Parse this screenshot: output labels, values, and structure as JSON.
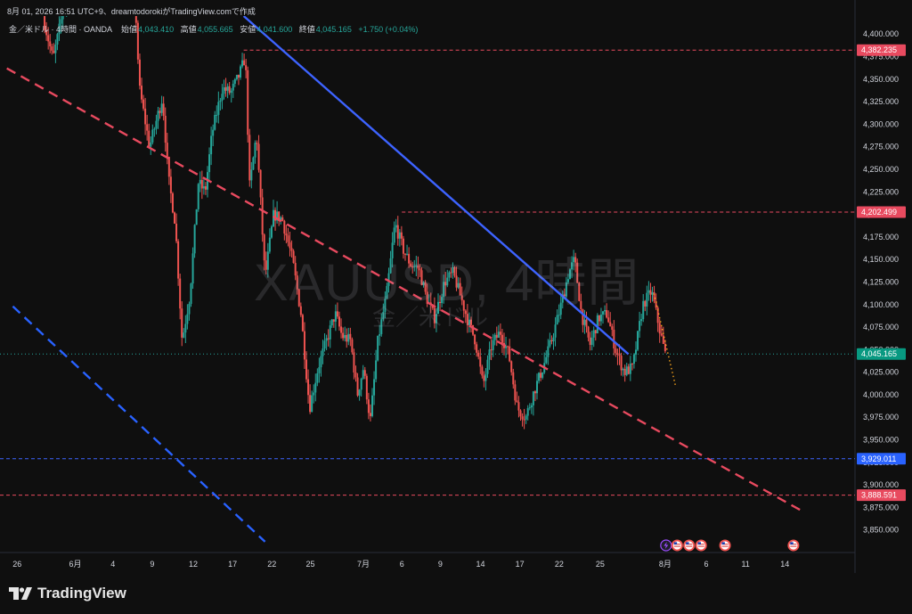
{
  "header": {
    "attribution": "8月 01, 2026 16:51 UTC+9、dreamtodorokiがTradingView.comで作成"
  },
  "legend": {
    "symbol_line": "金／米ドル · 4時間 · OANDA",
    "open_label": "始値",
    "open_value": "4,043.410",
    "high_label": "高値",
    "high_value": "4,055.665",
    "low_label": "安値",
    "low_value": "4,041.600",
    "close_label": "終値",
    "close_value": "4,045.165",
    "change_value": "+1.750 (+0.04%)"
  },
  "watermark": {
    "ticker": "XAUUSD, 4時間",
    "name": "金／米ドル"
  },
  "branding": {
    "name": "TradingView"
  },
  "colors": {
    "background": "#0f0f0f",
    "up": "#26a69a",
    "down": "#ef5350",
    "blue_trend": "#3d63ff",
    "red_dash": "#e84a5f",
    "blue_dash": "#2962ff"
  },
  "chart_data": {
    "type": "candlestick",
    "symbol": "XAUUSD",
    "timeframe": "4時間",
    "ylim": [
      3825,
      4420
    ],
    "y_ticks": [
      "4,400.000",
      "4,375.000",
      "4,350.000",
      "4,325.000",
      "4,300.000",
      "4,275.000",
      "4,250.000",
      "4,225.000",
      "4,200.000",
      "4,175.000",
      "4,150.000",
      "4,125.000",
      "4,100.000",
      "4,075.000",
      "4,050.000",
      "4,025.000",
      "4,000.000",
      "3,975.000",
      "3,950.000",
      "3,925.000",
      "3,900.000",
      "3,875.000",
      "3,850.000"
    ],
    "x_ticks": [
      {
        "label": "26",
        "pos": 0.02
      },
      {
        "label": "6月",
        "pos": 0.088
      },
      {
        "label": "4",
        "pos": 0.132
      },
      {
        "label": "9",
        "pos": 0.178
      },
      {
        "label": "12",
        "pos": 0.226
      },
      {
        "label": "17",
        "pos": 0.272
      },
      {
        "label": "22",
        "pos": 0.318
      },
      {
        "label": "25",
        "pos": 0.363
      },
      {
        "label": "7月",
        "pos": 0.425
      },
      {
        "label": "6",
        "pos": 0.47
      },
      {
        "label": "9",
        "pos": 0.515
      },
      {
        "label": "14",
        "pos": 0.562
      },
      {
        "label": "17",
        "pos": 0.608
      },
      {
        "label": "22",
        "pos": 0.654
      },
      {
        "label": "25",
        "pos": 0.702
      },
      {
        "label": "8月",
        "pos": 0.778
      },
      {
        "label": "6",
        "pos": 0.826
      },
      {
        "label": "11",
        "pos": 0.872
      },
      {
        "label": "14",
        "pos": 0.918
      }
    ],
    "price_path": [
      [
        0.05,
        4420
      ],
      [
        0.062,
        4372
      ],
      [
        0.075,
        4432
      ],
      [
        0.1,
        4455
      ],
      [
        0.13,
        4470
      ],
      [
        0.158,
        4440
      ],
      [
        0.163,
        4340
      ],
      [
        0.175,
        4275
      ],
      [
        0.19,
        4330
      ],
      [
        0.197,
        4240
      ],
      [
        0.205,
        4190
      ],
      [
        0.213,
        4060
      ],
      [
        0.222,
        4110
      ],
      [
        0.232,
        4235
      ],
      [
        0.24,
        4225
      ],
      [
        0.248,
        4290
      ],
      [
        0.26,
        4340
      ],
      [
        0.27,
        4335
      ],
      [
        0.28,
        4355
      ],
      [
        0.287,
        4375
      ],
      [
        0.292,
        4230
      ],
      [
        0.3,
        4290
      ],
      [
        0.31,
        4130
      ],
      [
        0.32,
        4200
      ],
      [
        0.33,
        4195
      ],
      [
        0.342,
        4150
      ],
      [
        0.352,
        4090
      ],
      [
        0.362,
        3985
      ],
      [
        0.372,
        4030
      ],
      [
        0.382,
        4060
      ],
      [
        0.392,
        4090
      ],
      [
        0.4,
        4065
      ],
      [
        0.41,
        4060
      ],
      [
        0.418,
        4000
      ],
      [
        0.425,
        4030
      ],
      [
        0.433,
        3970
      ],
      [
        0.442,
        4060
      ],
      [
        0.452,
        4110
      ],
      [
        0.462,
        4190
      ],
      [
        0.472,
        4160
      ],
      [
        0.48,
        4145
      ],
      [
        0.49,
        4140
      ],
      [
        0.498,
        4110
      ],
      [
        0.508,
        4085
      ],
      [
        0.52,
        4125
      ],
      [
        0.53,
        4135
      ],
      [
        0.54,
        4105
      ],
      [
        0.548,
        4080
      ],
      [
        0.556,
        4060
      ],
      [
        0.565,
        4010
      ],
      [
        0.575,
        4055
      ],
      [
        0.585,
        4070
      ],
      [
        0.595,
        4045
      ],
      [
        0.605,
        3985
      ],
      [
        0.615,
        3975
      ],
      [
        0.625,
        4005
      ],
      [
        0.635,
        4030
      ],
      [
        0.645,
        4060
      ],
      [
        0.655,
        4095
      ],
      [
        0.665,
        4135
      ],
      [
        0.672,
        4150
      ],
      [
        0.68,
        4090
      ],
      [
        0.69,
        4055
      ],
      [
        0.7,
        4085
      ],
      [
        0.71,
        4090
      ],
      [
        0.72,
        4050
      ],
      [
        0.73,
        4025
      ],
      [
        0.74,
        4030
      ],
      [
        0.752,
        4100
      ],
      [
        0.762,
        4115
      ],
      [
        0.772,
        4070
      ],
      [
        0.778,
        4045
      ]
    ],
    "dotted_projection": [
      [
        0.765,
        4112
      ],
      [
        0.79,
        4010
      ]
    ],
    "lines": [
      {
        "type": "trend",
        "style": "solid",
        "color": "blue",
        "points": [
          [
            0.285,
            4420
          ],
          [
            0.735,
            4045
          ]
        ]
      },
      {
        "type": "trend",
        "style": "dashed",
        "color": "red",
        "points": [
          [
            0.008,
            4362
          ],
          [
            0.94,
            3870
          ]
        ]
      },
      {
        "type": "trend",
        "style": "dashed",
        "color": "blue",
        "points": [
          [
            0.015,
            4098
          ],
          [
            0.31,
            3837
          ]
        ]
      },
      {
        "type": "horizontal",
        "style": "dashed",
        "color": "red",
        "price": 4382.235,
        "from": 0.285
      },
      {
        "type": "horizontal",
        "style": "dashed",
        "color": "red",
        "price": 4202.499,
        "from": 0.47
      },
      {
        "type": "horizontal",
        "style": "dashed",
        "color": "blue",
        "price": 3929.011,
        "from": 0.0
      },
      {
        "type": "horizontal",
        "style": "dashed",
        "color": "red",
        "price": 3888.591,
        "from": 0.0
      },
      {
        "type": "horizontal",
        "style": "dotted",
        "color": "green",
        "price": 4045.165,
        "from": 0.0
      }
    ],
    "price_labels": [
      {
        "text": "4,382.235",
        "price": 4382.235,
        "color": "#e84a5f"
      },
      {
        "text": "4,202.499",
        "price": 4202.499,
        "color": "#e84a5f"
      },
      {
        "text": "4,045.165",
        "price": 4045.165,
        "color": "#089981"
      },
      {
        "text": "3,929.011",
        "price": 3929.011,
        "color": "#2962ff"
      },
      {
        "text": "3,888.591",
        "price": 3888.591,
        "color": "#e84a5f"
      }
    ],
    "events": [
      {
        "kind": "lightning",
        "pos": 0.779
      },
      {
        "kind": "flag-us",
        "pos": 0.792
      },
      {
        "kind": "flag-us",
        "pos": 0.806
      },
      {
        "kind": "flag-us",
        "pos": 0.82
      },
      {
        "kind": "flag-us",
        "pos": 0.848
      },
      {
        "kind": "flag-us",
        "pos": 0.928
      }
    ]
  }
}
